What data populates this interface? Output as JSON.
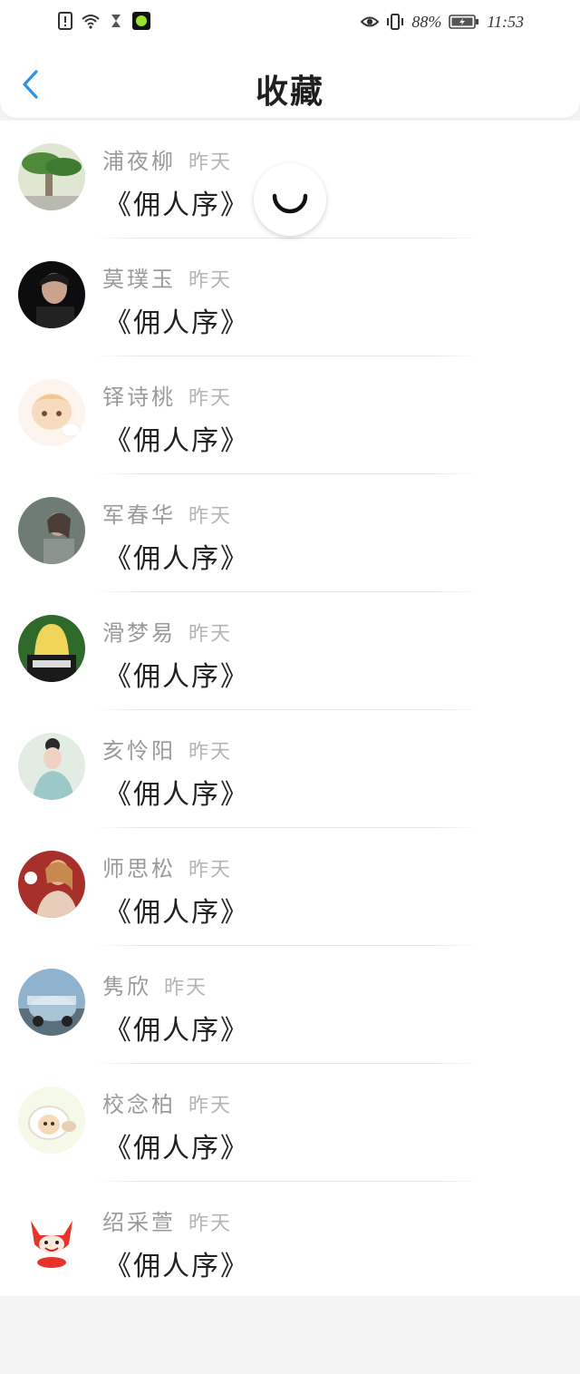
{
  "status_bar": {
    "battery": "88%",
    "time": "11:53",
    "icons_left": [
      "alert-icon",
      "wifi-icon",
      "hourglass-icon",
      "app-notification-icon"
    ],
    "icons_right": [
      "eye-icon",
      "vibrate-icon",
      "battery-icon"
    ]
  },
  "header": {
    "title": "收藏",
    "back_icon": "chevron-left-icon",
    "accent_color": "#2a93e8"
  },
  "favorites": [
    {
      "name": "浦夜柳",
      "time": "昨天",
      "work": "《佣人序》"
    },
    {
      "name": "莫璞玉",
      "time": "昨天",
      "work": "《佣人序》"
    },
    {
      "name": "铎诗桃",
      "time": "昨天",
      "work": "《佣人序》"
    },
    {
      "name": "军春华",
      "time": "昨天",
      "work": "《佣人序》"
    },
    {
      "name": "滑梦易",
      "time": "昨天",
      "work": "《佣人序》"
    },
    {
      "name": "亥怜阳",
      "time": "昨天",
      "work": "《佣人序》"
    },
    {
      "name": "师思松",
      "time": "昨天",
      "work": "《佣人序》"
    },
    {
      "name": "隽欣",
      "time": "昨天",
      "work": "《佣人序》"
    },
    {
      "name": "校念柏",
      "time": "昨天",
      "work": "《佣人序》"
    },
    {
      "name": "绍采萱",
      "time": "昨天",
      "work": "《佣人序》"
    }
  ]
}
